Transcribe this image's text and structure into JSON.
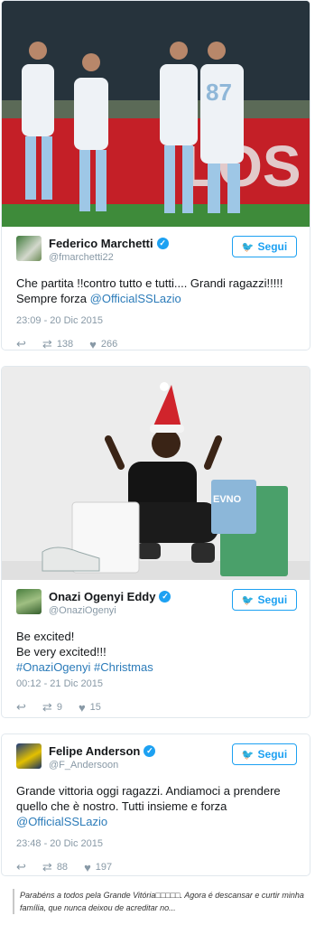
{
  "tweets": [
    {
      "name": "Federico Marchetti",
      "handle": "@fmarchetti22",
      "follow_label": "Segui",
      "text": "Che partita !!contro tutto e tutti.... Grandi ragazzi!!!!! Sempre forza ",
      "mention": "@OfficialSSLazio",
      "time": "23:09 - 20 Dic 2015",
      "retweets": "138",
      "likes": "266",
      "banner_text": "LOS"
    },
    {
      "name": "Onazi Ogenyi Eddy",
      "handle": "@OnaziOgenyi",
      "follow_label": "Segui",
      "line1": "Be excited!",
      "line2": "Be very excited!!!",
      "hashtags": "#OnaziOgenyi #Christmas",
      "time": "00:12 - 21 Dic 2015",
      "retweets": "9",
      "likes": "15",
      "bag_text": "EVNO"
    },
    {
      "name": "Felipe Anderson",
      "handle": "@F_Andersoon",
      "follow_label": "Segui",
      "text": "Grande vittoria oggi ragazzi. Andiamoci a prendere quello che è nostro. Tutti insieme e forza ",
      "mention": "@OfficialSSLazio",
      "time": "23:48 - 20 Dic 2015",
      "retweets": "88",
      "likes": "197"
    }
  ],
  "caption": "Parabéns a todos pela Grande Vitória□□□□□. Agora é descansar e curtir minha família, que nunca deixou de acreditar no...",
  "colors": {
    "twitter_blue": "#1da1f2",
    "link": "#2b7bb9",
    "muted": "#8899a6"
  },
  "icons": [
    "verified-icon",
    "twitter-bird-icon",
    "reply-icon",
    "retweet-icon",
    "heart-icon"
  ]
}
